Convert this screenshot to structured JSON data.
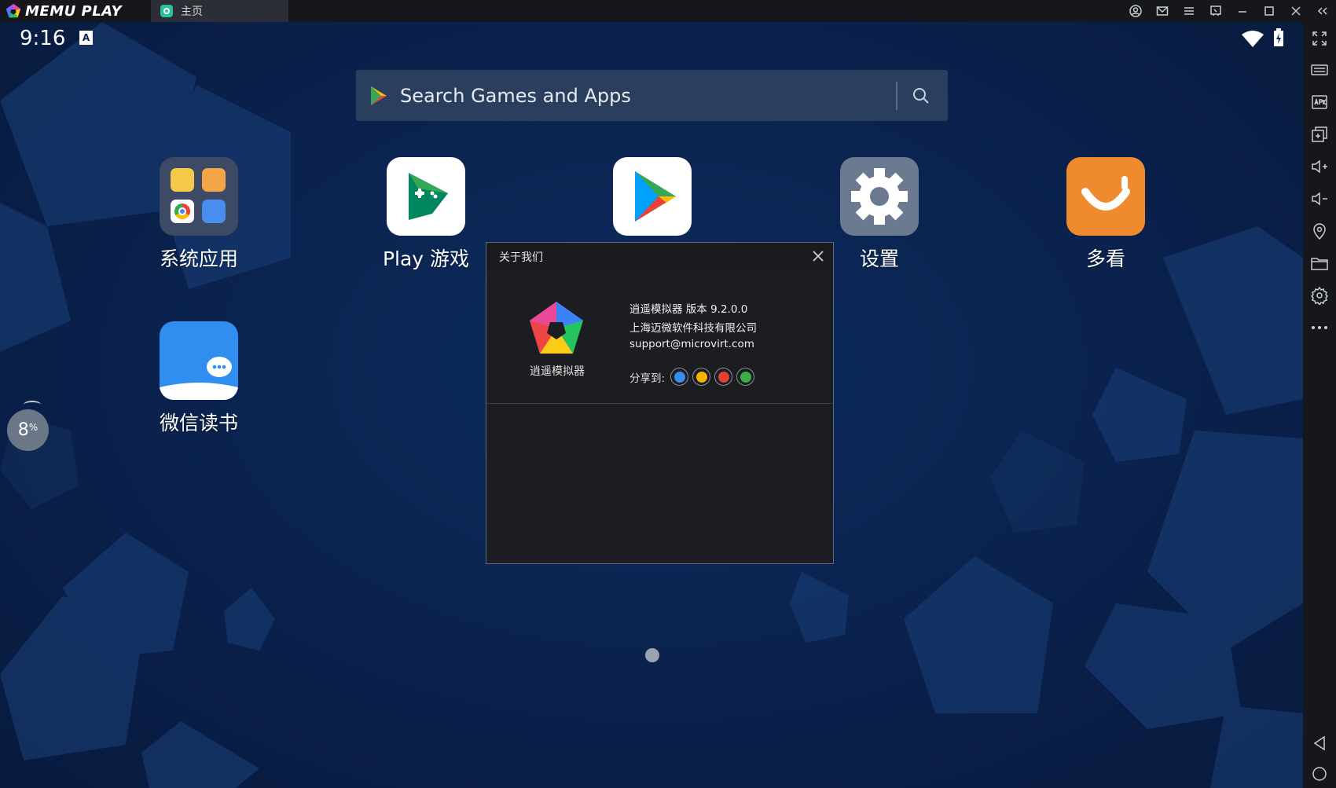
{
  "window": {
    "brand_name": "MEMU PLAY",
    "tab_label": "主页",
    "controls": [
      "user-icon",
      "mail-icon",
      "menu-icon",
      "pin-icon",
      "minimize-icon",
      "maximize-icon",
      "close-icon",
      "collapse-icon"
    ]
  },
  "status_bar": {
    "time": "9:16",
    "notification_glyph": "A"
  },
  "search": {
    "placeholder": "Search Games and Apps"
  },
  "apps": {
    "system_apps": "系统应用",
    "play_games": "Play 游戏",
    "settings": "设置",
    "duokan": "多看",
    "wechat_read": "微信读书"
  },
  "progress": {
    "value": "8",
    "unit": "%"
  },
  "dialog": {
    "title": "关于我们",
    "logo_label": "逍遥模拟器",
    "product_line": "逍遥模拟器  版本 9.2.0.0",
    "company": "上海迈微软件科技有限公司",
    "email": "support@microvirt.com",
    "share_label": "分享到:",
    "share_targets": [
      "qq-icon",
      "qzone-icon",
      "weibo-icon",
      "wechat-icon"
    ]
  },
  "sidebar": {
    "tools": [
      "fullscreen-icon",
      "keyboard-icon",
      "apk-icon",
      "multi-window-icon",
      "volume-up-icon",
      "volume-down-icon",
      "location-icon",
      "folder-icon",
      "settings-icon",
      "more-icon",
      "back-icon",
      "home-icon"
    ]
  },
  "colors": {
    "background": "#0b2350",
    "dialog_bg": "#1c1d20",
    "search_bg": "#2a3f5e",
    "accent_orange": "#ef8a2f"
  }
}
